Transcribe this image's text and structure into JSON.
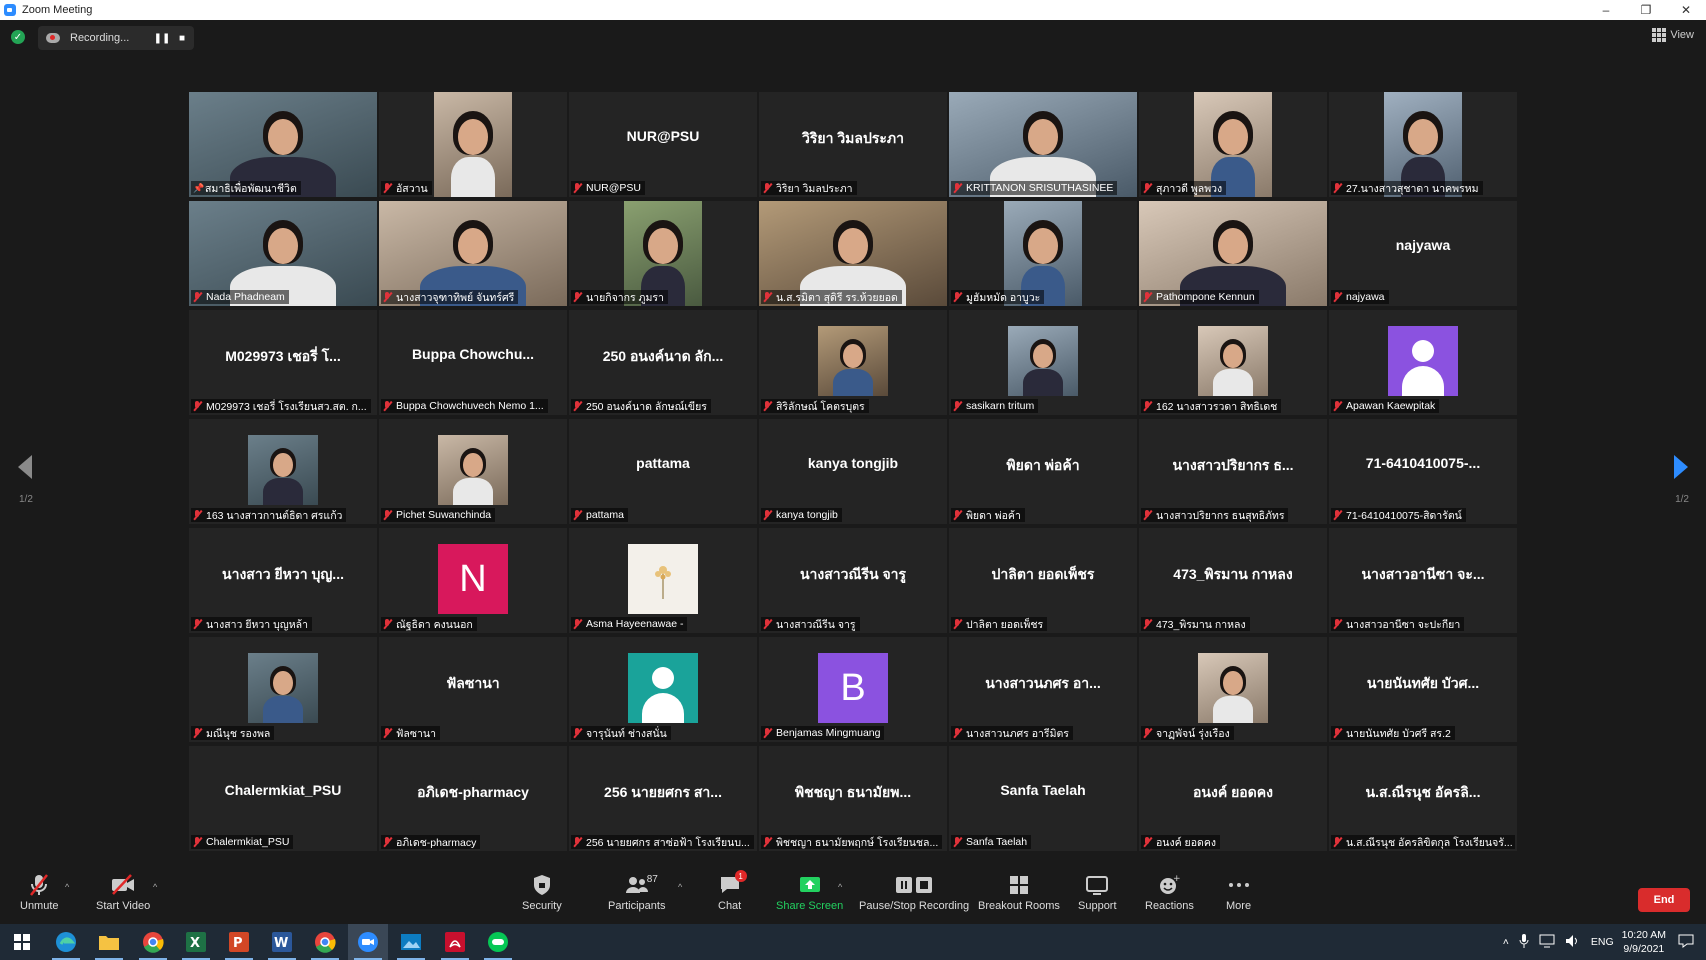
{
  "window": {
    "title": "Zoom Meeting",
    "minimize": "–",
    "restore": "❐",
    "close": "✕"
  },
  "recording": {
    "label": "Recording...",
    "pause": "❚❚",
    "stop": "■"
  },
  "view_label": "View",
  "pager": {
    "left": "1/2",
    "right": "1/2"
  },
  "tiles": [
    {
      "name": "สมาธิเพื่อพัฒนาชีวิต",
      "kind": "video",
      "active": true,
      "pinned": true
    },
    {
      "name": "อัสวาน",
      "kind": "video"
    },
    {
      "name": "NUR@PSU",
      "kind": "name",
      "display": "NUR@PSU"
    },
    {
      "name": "วิริยา วิมลประภา",
      "kind": "name",
      "display": "วิริยา วิมลประภา"
    },
    {
      "name": "KRITTANON SRISUTHASINEE",
      "kind": "video"
    },
    {
      "name": "สุภาวดี พูลพวง",
      "kind": "video"
    },
    {
      "name": "27.นางสาวสุชาดา นาคพรหม",
      "kind": "video"
    },
    {
      "name": "Nada Phadneam",
      "kind": "video"
    },
    {
      "name": "นางสาวจุฑาทิพย์ จันทร์ศรี",
      "kind": "video"
    },
    {
      "name": "นายกิจากร ภูมรา",
      "kind": "video"
    },
    {
      "name": "น.ส.รมิตา สุดิรี รร.ห้วยยอด",
      "kind": "video"
    },
    {
      "name": "มูฮัมหมัด อาบูวะ",
      "kind": "video"
    },
    {
      "name": "Pathompone Kennun",
      "kind": "video"
    },
    {
      "name": "najyawa",
      "kind": "name",
      "display": "najyawa"
    },
    {
      "name": "M029973 เชอรี่ โรงเรียนสว.สต. ก...",
      "kind": "name",
      "display": "M029973 เชอรี่ โ..."
    },
    {
      "name": "Buppa Chowchuvech Nemo 1...",
      "kind": "name",
      "display": "Buppa  Chowchu..."
    },
    {
      "name": "250 อนงค์นาด ลักษณ์เขียร",
      "kind": "name",
      "display": "250 อนงค์นาด ลัก..."
    },
    {
      "name": "สิริลักษณ์ โคตรบุตร",
      "kind": "photo"
    },
    {
      "name": "sasikarn tritum",
      "kind": "photo"
    },
    {
      "name": "162 นางสาวรวดา สิทธิเดช",
      "kind": "photo"
    },
    {
      "name": "Apawan Kaewpitak",
      "kind": "user",
      "color": "#8b52e0"
    },
    {
      "name": "163 นางสาวกานต์ธิดา ศรแก้ว",
      "kind": "photo"
    },
    {
      "name": "Pichet Suwanchinda",
      "kind": "photo"
    },
    {
      "name": "pattama",
      "kind": "name",
      "display": "pattama"
    },
    {
      "name": "kanya tongjib",
      "kind": "name",
      "display": "kanya tongjib"
    },
    {
      "name": "พิยดา พ่อค้า",
      "kind": "name",
      "display": "พิยดา พ่อค้า"
    },
    {
      "name": "นางสาวปริยากร ธนสุทธิภัทร",
      "kind": "name",
      "display": "นางสาวปริยากร ธ..."
    },
    {
      "name": "71-6410410075-สิดารัตน์",
      "kind": "name",
      "display": "71-6410410075-..."
    },
    {
      "name": "นางสาว ยีหวา บุญหล้า",
      "kind": "name",
      "display": "นางสาว ยีหวา บุญ..."
    },
    {
      "name": "ณัฐธิดา คงนนอก",
      "kind": "letter",
      "letter": "N",
      "color": "#d8185c"
    },
    {
      "name": "Asma Hayeenawae -",
      "kind": "flower"
    },
    {
      "name": "นางสาวณีรีน จารู",
      "kind": "name",
      "display": "นางสาวณีรีน จารู"
    },
    {
      "name": "ปาลิตา ยอดเพ็ชร",
      "kind": "name",
      "display": "ปาลิตา ยอดเพ็ชร"
    },
    {
      "name": "473_พิรมาน กาหลง",
      "kind": "name",
      "display": "473_พิรมาน กาหลง"
    },
    {
      "name": "นางสาวอานีซา จะปะกียา",
      "kind": "name",
      "display": "นางสาวอานีซา จะ..."
    },
    {
      "name": "มณีนุช รองพล",
      "kind": "photo"
    },
    {
      "name": "ฟัลซานา",
      "kind": "name",
      "display": "ฟัลซานา"
    },
    {
      "name": "จารุนันท์ ช่างสนั่น",
      "kind": "user",
      "color": "#1aa39a"
    },
    {
      "name": "Benjamas Mingmuang",
      "kind": "letter",
      "letter": "B",
      "color": "#8b52e0"
    },
    {
      "name": "นางสาวนภศร อารีมิตร",
      "kind": "name",
      "display": "นางสาวนภศร อา..."
    },
    {
      "name": "จาฏุพัจน์ รุ่งเรือง",
      "kind": "photo"
    },
    {
      "name": "นายนันทศัย บัวศรี สร.2",
      "kind": "name",
      "display": "นายนันทศัย บัวศ..."
    },
    {
      "name": "Chalermkiat_PSU",
      "kind": "name",
      "display": "Chalermkiat_PSU"
    },
    {
      "name": "อภิเดช-pharmacy",
      "kind": "name",
      "display": "อภิเดช-pharmacy"
    },
    {
      "name": "256 นายยศกร สาซ่อฟ้า โรงเรียนบ...",
      "kind": "name",
      "display": "256 นายยศกร สา..."
    },
    {
      "name": "พิชชญา ธนามัยพฤกษ์ โรงเรียนชล...",
      "kind": "name",
      "display": "พิชชญา ธนามัยพ..."
    },
    {
      "name": "Sanfa  Taelah",
      "kind": "name",
      "display": "Sanfa  Taelah"
    },
    {
      "name": "อนงค์ ยอดคง",
      "kind": "name",
      "display": "อนงค์ ยอดคง"
    },
    {
      "name": "น.ส.ณีรนุช อัครลิขิตกุล โรงเรียนจรั...",
      "kind": "name",
      "display": "น.ส.ณีรนุช อัครลิ..."
    }
  ],
  "toolbar": {
    "unmute": "Unmute",
    "start_video": "Start Video",
    "security": "Security",
    "participants": "Participants",
    "participants_count": "87",
    "chat": "Chat",
    "chat_badge": "1",
    "share_screen": "Share Screen",
    "pause_stop_recording": "Pause/Stop Recording",
    "breakout_rooms": "Breakout Rooms",
    "support": "Support",
    "reactions": "Reactions",
    "more": "More",
    "end": "End"
  },
  "taskbar": {
    "lang": "ENG",
    "time": "10:20 AM",
    "date": "9/9/2021"
  },
  "colors": {
    "accent_blue": "#2d8cff",
    "end_red": "#d92c2c",
    "share_green": "#23d160",
    "active_speaker": "#c8e04a"
  }
}
